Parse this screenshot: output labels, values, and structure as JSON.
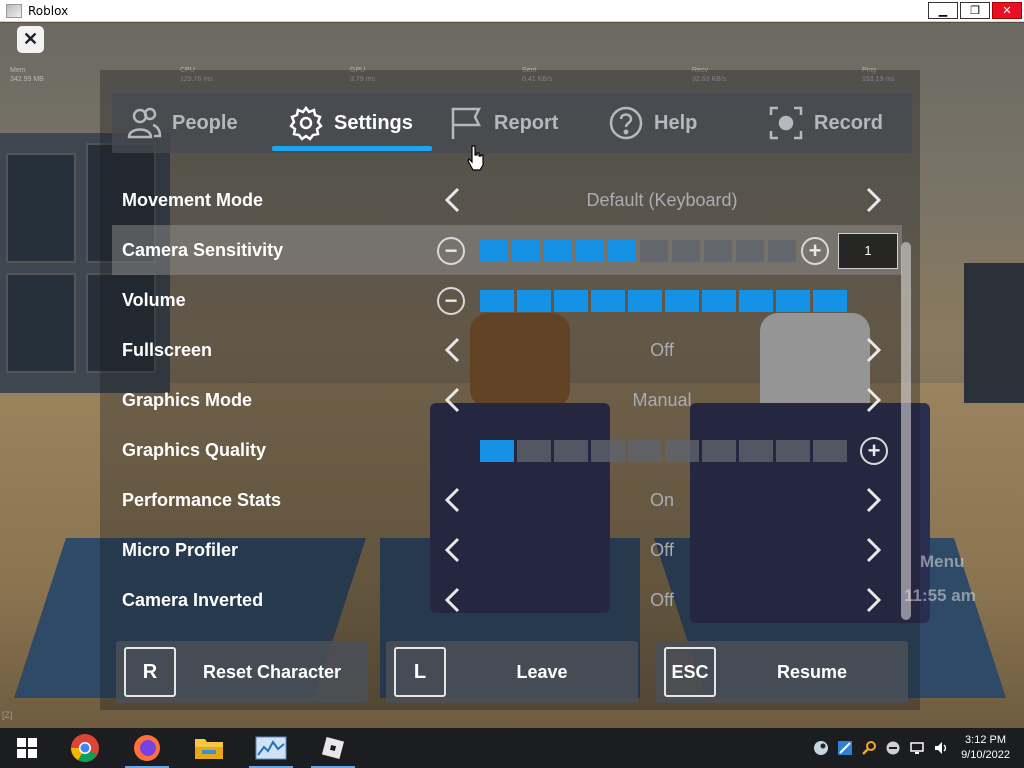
{
  "window": {
    "title": "Roblox",
    "minimize_label": "▁",
    "maximize_label": "❐",
    "close_label": "✕"
  },
  "stats": [
    {
      "name": "Mem",
      "value": "342.99 MB"
    },
    {
      "name": "CPU",
      "value": "129.76 ms"
    },
    {
      "name": "GPU",
      "value": "3.79 ms"
    },
    {
      "name": "Sent",
      "value": "0.41 KB/s"
    },
    {
      "name": "Recv",
      "value": "32.63 KB/s"
    },
    {
      "name": "Ping",
      "value": "153.19 ms"
    }
  ],
  "close_button": "✕",
  "tabs": [
    {
      "label": "People",
      "icon": "people-icon"
    },
    {
      "label": "Settings",
      "icon": "gear-icon",
      "active": true
    },
    {
      "label": "Report",
      "icon": "flag-icon"
    },
    {
      "label": "Help",
      "icon": "help-icon"
    },
    {
      "label": "Record",
      "icon": "record-icon"
    }
  ],
  "settings": {
    "movement_mode": {
      "label": "Movement Mode",
      "value": "Default (Keyboard)"
    },
    "camera_sensitivity": {
      "label": "Camera Sensitivity",
      "level": 5,
      "total": 10,
      "value": "1"
    },
    "volume": {
      "label": "Volume",
      "level": 10,
      "total": 10
    },
    "fullscreen": {
      "label": "Fullscreen",
      "value": "Off"
    },
    "graphics_mode": {
      "label": "Graphics Mode",
      "value": "Manual"
    },
    "graphics_quality": {
      "label": "Graphics Quality",
      "level": 1,
      "total": 10
    },
    "performance_stats": {
      "label": "Performance Stats",
      "value": "On"
    },
    "micro_profiler": {
      "label": "Micro Profiler",
      "value": "Off"
    },
    "camera_inverted": {
      "label": "Camera Inverted",
      "value": "Off"
    }
  },
  "buttons": {
    "reset": {
      "key": "R",
      "label": "Reset Character"
    },
    "leave": {
      "key": "L",
      "label": "Leave"
    },
    "resume": {
      "key": "ESC",
      "label": "Resume"
    }
  },
  "background_text": {
    "menu": "Menu",
    "time": "11:55 am",
    "z_key": "[Z]"
  },
  "taskbar": {
    "apps": [
      "windows-start-icon",
      "chrome-icon",
      "firefox-icon",
      "file-explorer-icon",
      "resource-monitor-icon",
      "roblox-icon"
    ],
    "clock_time": "3:12 PM",
    "clock_date": "9/10/2022"
  },
  "colors": {
    "accent": "#1592e6",
    "tab_underline": "#1fa5ee"
  }
}
